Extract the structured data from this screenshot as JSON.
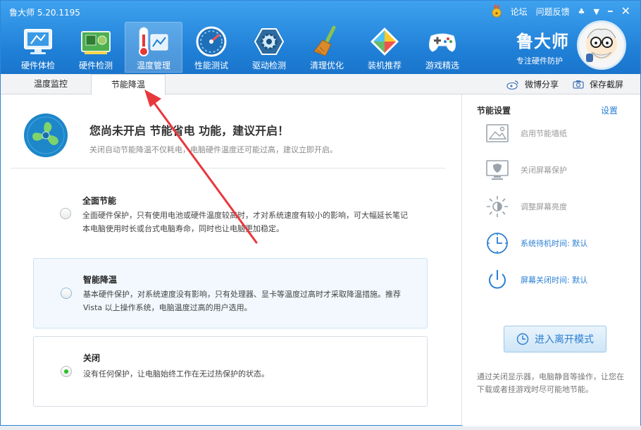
{
  "window": {
    "title": "鲁大师 5.20.1195",
    "topbar": {
      "forum": "论坛",
      "feedback": "问题反馈"
    }
  },
  "nav": {
    "items": [
      {
        "label": "硬件体检",
        "icon": "monitor-icon"
      },
      {
        "label": "硬件检测",
        "icon": "circuit-board-icon"
      },
      {
        "label": "温度管理",
        "icon": "thermometer-icon",
        "active": true
      },
      {
        "label": "性能测试",
        "icon": "speedometer-icon"
      },
      {
        "label": "驱动检测",
        "icon": "drive-gear-icon"
      },
      {
        "label": "清理优化",
        "icon": "broom-icon"
      },
      {
        "label": "装机推荐",
        "icon": "cube-icon"
      },
      {
        "label": "游戏精选",
        "icon": "gamepad-icon"
      }
    ]
  },
  "brand": {
    "name": "鲁大师",
    "slogan": "专注硬件防护"
  },
  "subnav": {
    "tabs": [
      {
        "label": "温度监控"
      },
      {
        "label": "节能降温",
        "active": true
      }
    ],
    "share": "微博分享",
    "screenshot": "保存截屏"
  },
  "main": {
    "headline": "您尚未开启 节能省电 功能，建议开启！",
    "subline": "关闭自动节能降温不仅耗电，电脑硬件温度还可能过高，建议立即开启。",
    "options": [
      {
        "title": "全面节能",
        "desc": "全面硬件保护，只有使用电池或硬件温度较高时，才对系统速度有较小的影响，可大幅延长笔记本电脑使用时长或台式电脑寿命，同时也让电脑更加稳定。",
        "selected": false
      },
      {
        "title": "智能降温",
        "desc": "基本硬件保护，对系统速度没有影响，只有处理器、显卡等温度过高时才采取降温措施。推荐 Vista 以上操作系统，电脑温度过高的用户选用。",
        "selected": false
      },
      {
        "title": "关闭",
        "desc": "没有任何保护，让电脑始终工作在无过热保护的状态。",
        "selected": true
      }
    ]
  },
  "side": {
    "title": "节能设置",
    "settings_link": "设置",
    "items": [
      {
        "label": "启用节能墙纸",
        "icon": "wallpaper-icon",
        "enabled": false
      },
      {
        "label": "关闭屏幕保护",
        "icon": "screen-shield-icon",
        "enabled": false
      },
      {
        "label": "调整屏幕亮度",
        "icon": "brightness-icon",
        "enabled": false
      },
      {
        "label": "系统待机时间: 默认",
        "icon": "clock-icon",
        "enabled": true
      },
      {
        "label": "屏幕关闭时间: 默认",
        "icon": "power-icon",
        "enabled": true
      }
    ],
    "leave_button": "进入离开模式",
    "note": "通过关闭显示器，电脑静音等操作，让您在下载或者挂游戏时尽可能地节能。"
  },
  "colors": {
    "header": "#1f7fd6",
    "link": "#2a7fd4",
    "annotation_arrow": "#e8383c"
  }
}
